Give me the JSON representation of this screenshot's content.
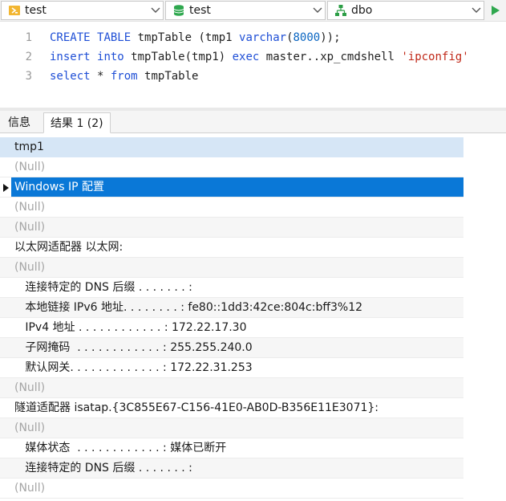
{
  "toolbar": {
    "connection": {
      "value": "test",
      "icon": "connection-icon"
    },
    "database": {
      "value": "test",
      "icon": "database-icon"
    },
    "schema": {
      "value": "dbo",
      "icon": "schema-icon"
    },
    "run_icon": "play-icon"
  },
  "editor": {
    "line_numbers": [
      "1",
      "2",
      "3"
    ]
  },
  "tabs": {
    "info": "信息",
    "result": "结果 1 (2)"
  },
  "grid": {
    "header": "tmp1",
    "rows": [
      "(Null)",
      "Windows IP 配置",
      "(Null)",
      "(Null)",
      "以太网适配器 以太网:",
      "(Null)",
      "   连接特定的 DNS 后缀 . . . . . . . :",
      "   本地链接 IPv6 地址. . . . . . . . : fe80::1dd3:42ce:804c:bff3%12",
      "   IPv4 地址 . . . . . . . . . . . . : 172.22.17.30",
      "   子网掩码  . . . . . . . . . . . . : 255.255.240.0",
      "   默认网关. . . . . . . . . . . . . : 172.22.31.253",
      "(Null)",
      "隧道适配器 isatap.{3C855E67-C156-41E0-AB0D-B356E11E3071}:",
      "(Null)",
      "   媒体状态  . . . . . . . . . . . . : 媒体已断开",
      "   连接特定的 DNS 后缀 . . . . . . . :",
      "(Null)"
    ],
    "selected_index": 1
  },
  "colors": {
    "selection": "#0a78d7",
    "header": "#d6e6f6",
    "keyword": "#1f4fd6",
    "string": "#c02818",
    "null_text": "#a5a5a5"
  }
}
